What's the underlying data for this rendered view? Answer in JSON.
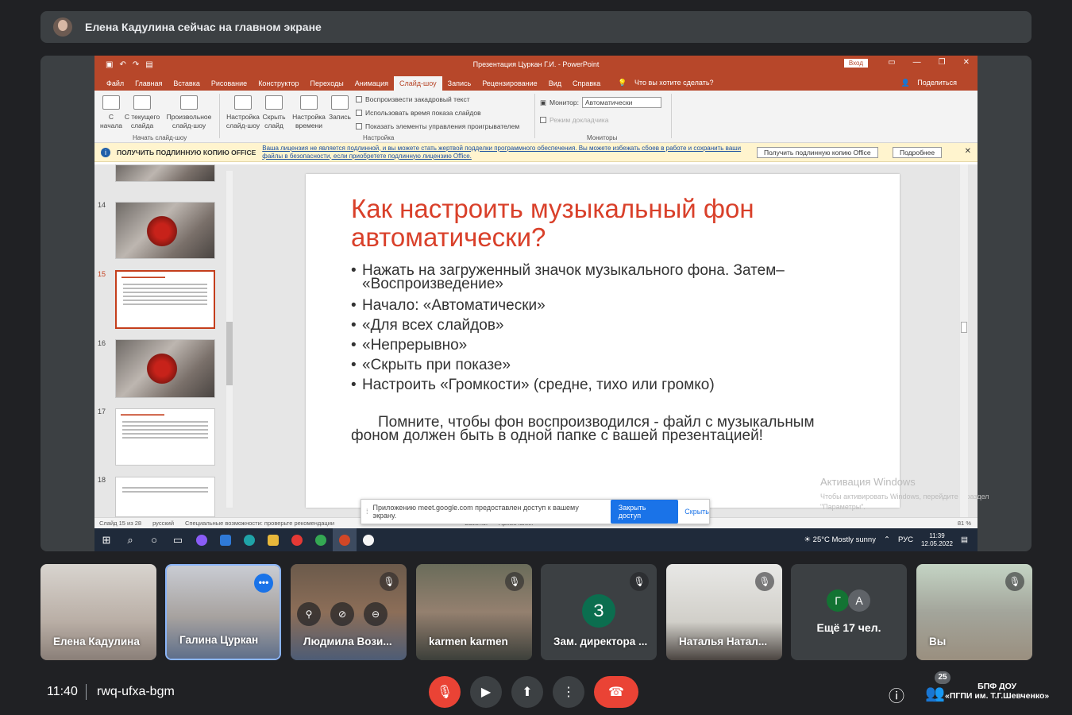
{
  "banner": {
    "text": "Елена Кадулина сейчас на главном экране"
  },
  "ppt": {
    "window_title": "Презентация Цуркан Г.И.  -  PowerPoint",
    "login": "Вход",
    "menu": [
      "Файл",
      "Главная",
      "Вставка",
      "Рисование",
      "Конструктор",
      "Переходы",
      "Анимация",
      "Слайд-шоу",
      "Запись",
      "Рецензирование",
      "Вид",
      "Справка"
    ],
    "active_menu": "Слайд-шоу",
    "tell_me": "Что вы хотите сделать?",
    "share": "Поделиться",
    "ribbon": {
      "b1": "С\nначала",
      "b2": "С текущего\nслайда",
      "b3": "Произвольное\nслайд-шоу",
      "group1": "Начать слайд-шоу",
      "b4": "Настройка\nслайд-шоу",
      "b5": "Скрыть\nслайд",
      "b6": "Настройка\nвремени",
      "b7": "Запись",
      "cb1": "Воспроизвести закадровый текст",
      "cb2": "Использовать время показа слайдов",
      "cb3": "Показать элементы управления проигрывателем",
      "group2": "Настройка",
      "monitor_label": "Монитор:",
      "monitor_value": "Автоматически",
      "presenter_mode": "Режим докладчика",
      "group3": "Мониторы"
    },
    "warning": {
      "head": "ПОЛУЧИТЬ ПОДЛИННУЮ КОПИЮ OFFICE",
      "msg": "Ваша лицензия не является подлинной, и вы можете стать жертвой подделки программного обеспечения. Вы можете избежать сбоев в работе и сохранить ваши файлы в безопасности, если приобретете подлинную лицензию Office.",
      "btn1": "Получить подлинную копию Office",
      "btn2": "Подробнее"
    },
    "thumb_numbers": [
      "14",
      "15",
      "16",
      "17",
      "18"
    ],
    "slide": {
      "title": "Как настроить музыкальный фон автоматически?",
      "bullets": [
        "Нажать на загруженный значок музыкального фона. Затем– «Воспроизведение»",
        "Начало: «Автоматически»",
        "«Для всех слайдов»",
        "«Непрерывно»",
        "«Скрыть при показе»",
        "Настроить «Громкости» (средне, тихо или громко)"
      ],
      "note": "Помните, чтобы фон воспроизводился - файл с музыкальным фоном должен быть в одной папке с вашей презентацией!"
    },
    "watermark": {
      "line1": "Активация Windows",
      "line2": "Чтобы активировать Windows, перейдите в раздел \"Параметры\"."
    },
    "sharebar": {
      "text": "Приложению meet.google.com предоставлен доступ к вашему экрану.",
      "stop": "Закрыть доступ",
      "hide": "Скрыть"
    },
    "status": {
      "slide": "Слайд 15 из 28",
      "lang": "русский",
      "access": "Специальные возможности: проверьте рекомендации",
      "notes": "Заметки",
      "comments": "Примечания",
      "zoom": "81 %"
    },
    "taskbar": {
      "weather": "25°C  Mostly sunny",
      "lang": "РУС",
      "time": "11:39",
      "date": "12.05.2022"
    }
  },
  "participants": [
    {
      "name": "Елена Кадулина"
    },
    {
      "name": "Галина Цуркан"
    },
    {
      "name": "Людмила Вози..."
    },
    {
      "name": "karmen karmen"
    },
    {
      "name": "Зам. директора ...",
      "letter": "З"
    },
    {
      "name": "Наталья Натал..."
    },
    {
      "name": "Ещё 17 чел.",
      "avatars": [
        "Г",
        "А"
      ]
    },
    {
      "name": "Вы"
    }
  ],
  "bottom": {
    "time": "11:40",
    "code": "rwq-ufxa-bgm",
    "people_count": "25",
    "brand_line1": "БПФ ДОУ",
    "brand_line2": "«ПГПИ им. Т.Г.Шевченко»"
  },
  "colors": {
    "ppt_red": "#b7472a",
    "meet_bg": "#202124",
    "end_call": "#ea4335"
  }
}
